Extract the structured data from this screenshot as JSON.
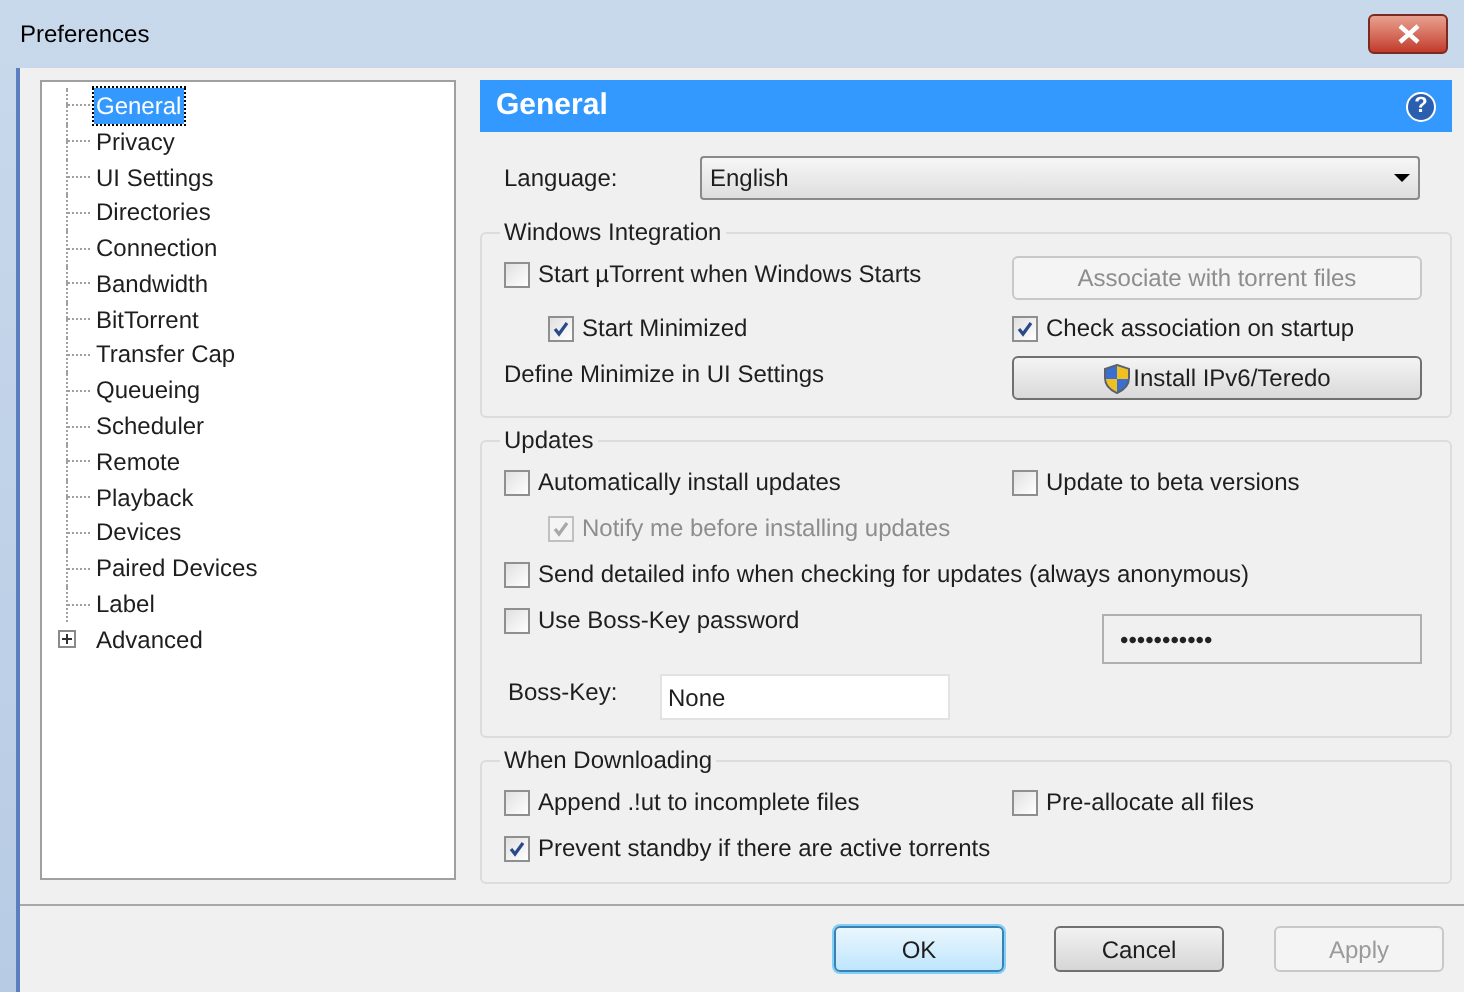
{
  "window": {
    "title": "Preferences"
  },
  "tree": [
    {
      "label": "General",
      "selected": true,
      "kind": "leaf"
    },
    {
      "label": "Privacy",
      "selected": false,
      "kind": "leaf"
    },
    {
      "label": "UI Settings",
      "selected": false,
      "kind": "leaf"
    },
    {
      "label": "Directories",
      "selected": false,
      "kind": "leaf"
    },
    {
      "label": "Connection",
      "selected": false,
      "kind": "leaf"
    },
    {
      "label": "Bandwidth",
      "selected": false,
      "kind": "leaf"
    },
    {
      "label": "BitTorrent",
      "selected": false,
      "kind": "leaf"
    },
    {
      "label": "Transfer Cap",
      "selected": false,
      "kind": "leaf"
    },
    {
      "label": "Queueing",
      "selected": false,
      "kind": "leaf"
    },
    {
      "label": "Scheduler",
      "selected": false,
      "kind": "leaf"
    },
    {
      "label": "Remote",
      "selected": false,
      "kind": "leaf"
    },
    {
      "label": "Playback",
      "selected": false,
      "kind": "leaf"
    },
    {
      "label": "Devices",
      "selected": false,
      "kind": "leaf"
    },
    {
      "label": "Paired Devices",
      "selected": false,
      "kind": "leaf"
    },
    {
      "label": "Label",
      "selected": false,
      "kind": "leaf"
    },
    {
      "label": "Advanced",
      "selected": false,
      "kind": "collapsed"
    }
  ],
  "panel": {
    "header": "General",
    "help": "?",
    "language": {
      "label": "Language:",
      "value": "English"
    },
    "groups": [
      {
        "title": "Windows Integration",
        "rows": [
          {
            "left": {
              "kind": "checkbox",
              "label": "Start µTorrent when Windows Starts",
              "checked": false,
              "disabled": false
            },
            "right": {
              "kind": "button",
              "label": "Associate with torrent files",
              "disabled": true
            }
          },
          {
            "left": {
              "kind": "checkbox",
              "label": "Start Minimized",
              "checked": true,
              "disabled": false,
              "indent": true
            },
            "right": {
              "kind": "checkbox",
              "label": "Check association on startup",
              "checked": true,
              "disabled": false
            }
          },
          {
            "left": {
              "kind": "text",
              "label": "Define Minimize in UI Settings"
            },
            "right": {
              "kind": "shield_button",
              "label": "Install IPv6/Teredo",
              "disabled": false
            }
          }
        ]
      },
      {
        "title": "Updates",
        "rows": [
          {
            "left": {
              "kind": "checkbox",
              "label": "Automatically install updates",
              "checked": false,
              "disabled": false
            },
            "right": {
              "kind": "checkbox",
              "label": "Update to beta versions",
              "checked": false,
              "disabled": false
            }
          },
          {
            "left": {
              "kind": "checkbox",
              "label": "Notify me before installing updates",
              "checked": true,
              "disabled": true,
              "indent": true
            }
          },
          {
            "left": {
              "kind": "checkbox",
              "label": "Send detailed info when checking for updates (always anonymous)",
              "checked": false,
              "disabled": false
            }
          },
          {
            "left": {
              "kind": "checkbox",
              "label": "Use Boss-Key password",
              "checked": false,
              "disabled": false
            },
            "right": {
              "kind": "password",
              "value": "•••••••••••",
              "disabled": true
            }
          },
          {
            "left": {
              "kind": "field",
              "label": "Boss-Key:",
              "value": "None"
            }
          }
        ]
      },
      {
        "title": "When Downloading",
        "rows": [
          {
            "left": {
              "kind": "checkbox",
              "label": "Append .!ut to incomplete files",
              "checked": false,
              "disabled": false
            },
            "right": {
              "kind": "checkbox",
              "label": "Pre-allocate all files",
              "checked": false,
              "disabled": false
            }
          },
          {
            "left": {
              "kind": "checkbox",
              "label": "Prevent standby if there are active torrents",
              "checked": true,
              "disabled": false
            }
          }
        ]
      }
    ]
  },
  "buttons": [
    {
      "label": "OK",
      "kind": "default",
      "disabled": false
    },
    {
      "label": "Cancel",
      "kind": "normal",
      "disabled": false
    },
    {
      "label": "Apply",
      "kind": "normal",
      "disabled": true
    }
  ]
}
